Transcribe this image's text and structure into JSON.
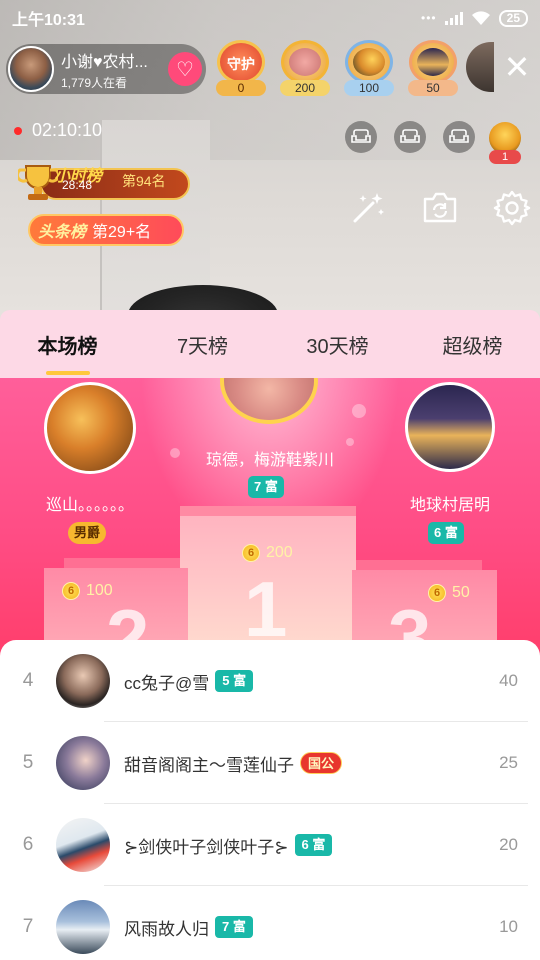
{
  "status_bar": {
    "time": "上午10:31",
    "battery": "25"
  },
  "host": {
    "name": "小谢♥农村...",
    "viewers": "1,779人在看",
    "follow_icon": "heart-plus-icon"
  },
  "top_badges": [
    {
      "label": "守护",
      "value": "0",
      "kind": "guard"
    },
    {
      "value": "200",
      "kind": "r1"
    },
    {
      "value": "100",
      "kind": "r2"
    },
    {
      "value": "50",
      "kind": "r3"
    }
  ],
  "timer": "02:10:10",
  "seat_user_count": "1",
  "hour_rank": {
    "title": "小时榜",
    "time": "28:48",
    "rank": "第94名"
  },
  "headline_rank": {
    "title": "头条榜",
    "rank": "第29+名"
  },
  "tabs": [
    {
      "label": "本场榜",
      "active": true
    },
    {
      "label": "7天榜",
      "active": false
    },
    {
      "label": "30天榜",
      "active": false
    },
    {
      "label": "超级榜",
      "active": false
    }
  ],
  "podium": {
    "first": {
      "name": "琼德，梅游鞋紫川",
      "tag": "7 富",
      "score": "200",
      "place": "1"
    },
    "second": {
      "name": "巡山。。。。。。",
      "tag": "男爵",
      "score": "100",
      "place": "2"
    },
    "third": {
      "name": "地球村居明",
      "tag": "6 富",
      "score": "50",
      "place": "3"
    }
  },
  "list": [
    {
      "rank": "4",
      "name": "cc兔子@雪",
      "tag": "5 富",
      "tag_kind": "rich",
      "score": "40"
    },
    {
      "rank": "5",
      "name": "甜音阁阁主～雪莲仙子",
      "tag": "国公",
      "tag_kind": "gov",
      "score": "25"
    },
    {
      "rank": "6",
      "name": "⊱剑侠叶子剑侠叶子⊱",
      "tag": "6 富",
      "tag_kind": "rich",
      "score": "20"
    },
    {
      "rank": "7",
      "name": "风雨故人归",
      "tag": "7 富",
      "tag_kind": "rich",
      "score": "10"
    }
  ],
  "colors": {
    "accent_pink": "#ff4d85",
    "rich_tag": "#19b8a8",
    "tab_bar": "#fdd9e6",
    "active_underline": "#ffc83c"
  }
}
